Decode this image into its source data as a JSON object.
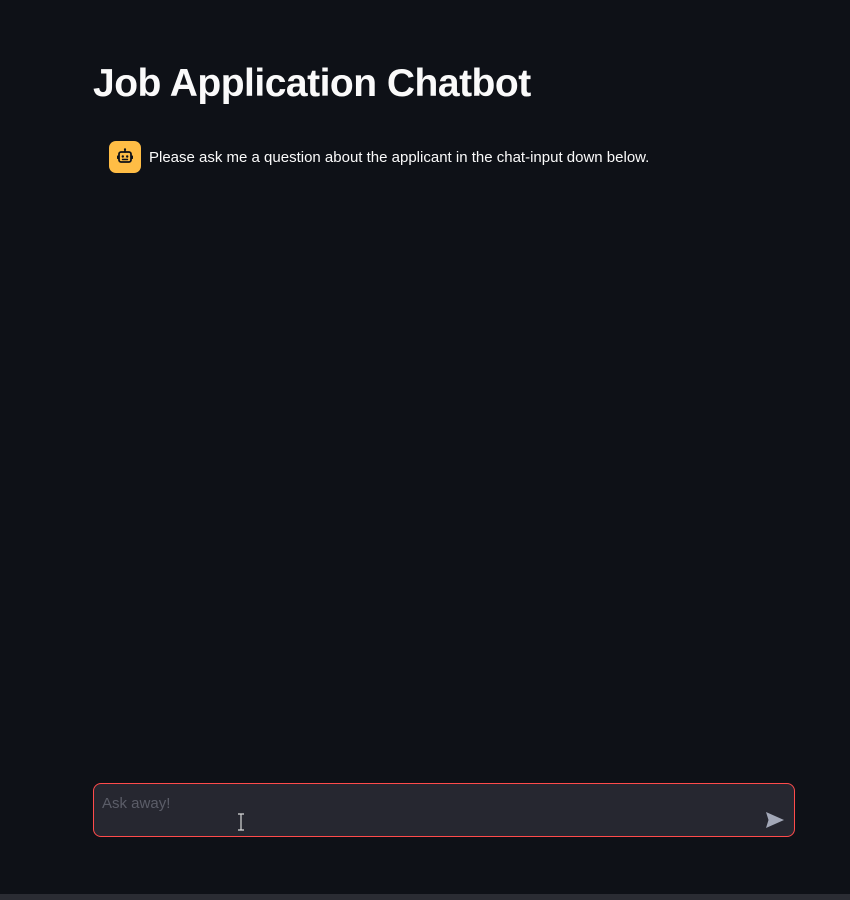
{
  "app": {
    "title": "Job Application Chatbot"
  },
  "messages": [
    {
      "role": "assistant",
      "avatar_icon": "robot-icon",
      "avatar_color": "#ffbd45",
      "text": "Please ask me a question about the applicant in the chat-input down below."
    }
  ],
  "chat_input": {
    "placeholder": "Ask away!",
    "value": "",
    "send_icon": "send-icon",
    "border_color": "#ff4b4b"
  },
  "colors": {
    "background": "#0e1117",
    "input_background": "#262730",
    "text": "#fafafa"
  }
}
